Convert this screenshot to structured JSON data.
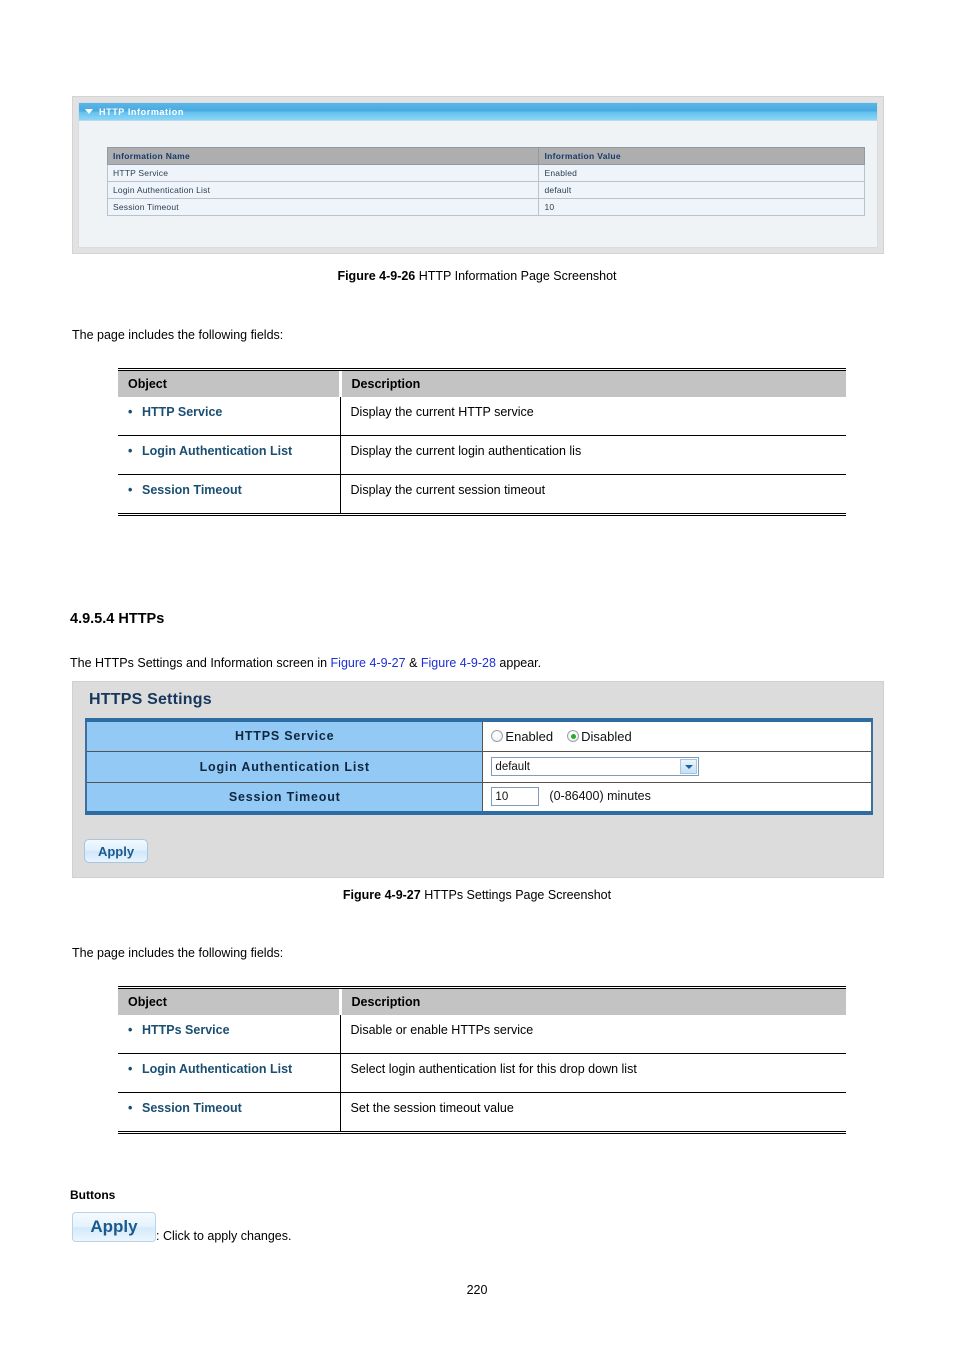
{
  "figure1": {
    "panel_title": "HTTP Information",
    "collapse_icon": "triangle-down-icon",
    "table": {
      "headers": [
        "Information Name",
        "Information Value"
      ],
      "rows": [
        [
          "HTTP Service",
          "Enabled"
        ],
        [
          "Login Authentication List",
          "default"
        ],
        [
          "Session Timeout",
          "10"
        ]
      ]
    },
    "caption_bold": "Figure 4-9-26",
    "caption_text": " HTTP Information Page Screenshot"
  },
  "intro1": "The page includes the following fields:",
  "table1": {
    "headers": [
      "Object",
      "Description"
    ],
    "rows": [
      {
        "object": "HTTP Service",
        "description": "Display the current HTTP service"
      },
      {
        "object": "Login Authentication List",
        "description": "Display the current login authentication lis"
      },
      {
        "object": "Session Timeout",
        "description": "Display the current session timeout"
      }
    ]
  },
  "section": {
    "heading": "4.9.5.4 HTTPs",
    "intro_part1": "The HTTPs Settings and Information screen in ",
    "link1": "Figure 4-9-27",
    "intro_part2": " & ",
    "link2": "Figure 4-9-28",
    "intro_part3": " appear."
  },
  "figure2": {
    "panel_title": "HTTPS Settings",
    "fields": [
      {
        "label": "HTTPS Service"
      },
      {
        "label": "Login Authentication List"
      },
      {
        "label": "Session Timeout"
      }
    ],
    "radio_enabled_label": "Enabled",
    "radio_disabled_label": "Disabled",
    "radio_selected": "Disabled",
    "select_value": "default",
    "select_options": [
      "default"
    ],
    "timeout_value": "10",
    "timeout_hint": "(0-86400) minutes",
    "apply_label": "Apply",
    "caption_bold": "Figure 4-9-27",
    "caption_text": " HTTPs Settings Page Screenshot"
  },
  "intro2": "The page includes the following fields:",
  "table2": {
    "headers": [
      "Object",
      "Description"
    ],
    "rows": [
      {
        "object": "HTTPs Service",
        "description": "Disable or enable HTTPs service"
      },
      {
        "object": "Login Authentication List",
        "description": "Select login authentication list for this drop down list"
      },
      {
        "object": "Session Timeout",
        "description": "Set the session timeout value"
      }
    ]
  },
  "buttons": {
    "heading": "Buttons",
    "apply_label": "Apply",
    "apply_description": ": Click to apply changes."
  },
  "page_number": "220",
  "colors": {
    "panel_header_blue": "#49a9e0",
    "form_label_blue": "#93c9f5",
    "form_border_blue": "#2e6da4",
    "object_link_navy": "#1b4f72",
    "doc_link_blue": "#1d2fd6",
    "radio_selected_green": "#2ea82e",
    "table_header_gray": "#c3c3c3"
  }
}
